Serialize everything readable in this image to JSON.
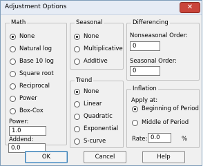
{
  "window": {
    "title": "Adjustment Options",
    "close_label": "✕"
  },
  "math": {
    "legend": "Math",
    "options": [
      "None",
      "Natural log",
      "Base 10 log",
      "Square root",
      "Reciprocal",
      "Power",
      "Box-Cox"
    ],
    "selected": "None",
    "power_label": "Power:",
    "power_value": "1.0",
    "addend_label": "Addend:",
    "addend_value": "0.0"
  },
  "seasonal": {
    "legend": "Seasonal",
    "options": [
      "None",
      "Multiplicative",
      "Additive"
    ],
    "selected": "None"
  },
  "trend": {
    "legend": "Trend",
    "options": [
      "None",
      "Linear",
      "Quadratic",
      "Exponential",
      "S-curve"
    ],
    "selected": "None"
  },
  "differencing": {
    "legend": "Differencing",
    "nonseasonal_label": "Nonseasonal Order:",
    "nonseasonal_value": "0",
    "seasonal_label": "Seasonal Order:",
    "seasonal_value": "0"
  },
  "inflation": {
    "legend": "Inflation",
    "apply_label": "Apply at:",
    "options": [
      "Beginning of Period",
      "Middle of Period"
    ],
    "selected": "Beginning of Period",
    "rate_label": "Rate:",
    "rate_value": "0.0",
    "rate_unit": "%"
  },
  "buttons": {
    "ok": "OK",
    "cancel": "Cancel",
    "help": "Help"
  }
}
